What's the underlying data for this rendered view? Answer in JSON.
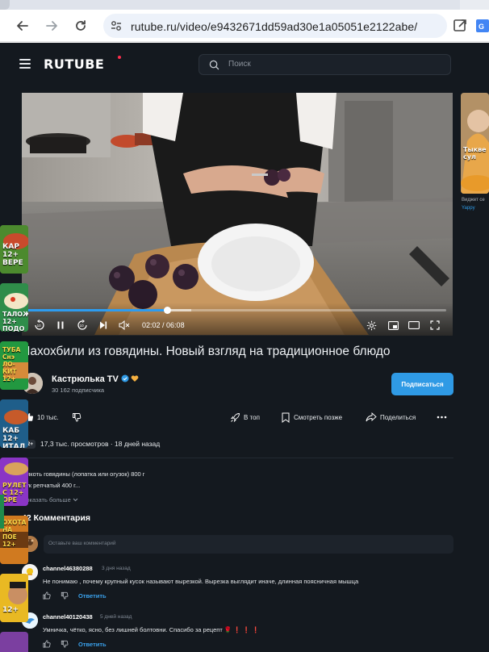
{
  "browser": {
    "url": "rutube.ru/video/e9432671dd59ad30e1a05051e2122abe/"
  },
  "header": {
    "logo_text": "RUTUBE",
    "search_placeholder": "Поиск"
  },
  "player": {
    "time_current": "02:02",
    "time_total": "06:08",
    "progress_fraction": 0.33,
    "buffered_fraction": 0.39,
    "skip_seconds": "10"
  },
  "video": {
    "title": "Чахохбили из говядины. Новый взгляд на традиционное блюдо"
  },
  "channel": {
    "name": "Кастрюлька TV",
    "subscribers": "30 162 подписчика",
    "subscribe_label": "Подписаться"
  },
  "actions": {
    "likes": "10 тыс.",
    "top_label": "В топ",
    "watch_later_label": "Смотреть позже",
    "share_label": "Поделиться"
  },
  "meta": {
    "age": "12+",
    "stats": "17,3 тыс. просмотров  ·  18 дней назад"
  },
  "description": {
    "line1": "Мякоть говядины (лопатка или огузок) 800 г",
    "line2": "Лук репчатый 400 г...",
    "show_more": "Показать больше"
  },
  "comments": {
    "title": "42 Комментария",
    "input_placeholder": "Оставьте ваш комментарий",
    "items": [
      {
        "user": "channel46380288",
        "time": "3 дня назад",
        "text": "Не понимаю , почему крупный кусок называют вырезкой. Вырезка выглядит иначе, длинная поясничная мышца",
        "reply": "Ответить"
      },
      {
        "user": "channel40120438",
        "time": "5 дней назад",
        "text": "Умничка, чётко, ясно, без лишней болтовни. Спасибо за рецепт 🌹 ❗ ❗ ❗",
        "reply": "Ответить"
      }
    ]
  },
  "sidebar": {
    "widget_title": "Виджет се",
    "widget_source": "Yappy",
    "thumbs": [
      {
        "label": "Тыкве сул"
      },
      {
        "label": "КАР 12+ ВЕРЕ"
      },
      {
        "label": "ТАЛОЖН 12+ ПОДО"
      },
      {
        "label": "ТУБА Снэ ЛО-КИТ 12+"
      },
      {
        "label": "КАБ 12+ ИТАЛ"
      },
      {
        "label": "РУЛЕТ С 12+ ОРЕ"
      },
      {
        "label": "ОХОТА НА ПОЕ 12+"
      },
      {
        "label": "12+"
      }
    ]
  },
  "colors": {
    "page_bg": "#14191f",
    "accent": "#2f9ae5",
    "logo_dot": "#ff2e4d"
  }
}
